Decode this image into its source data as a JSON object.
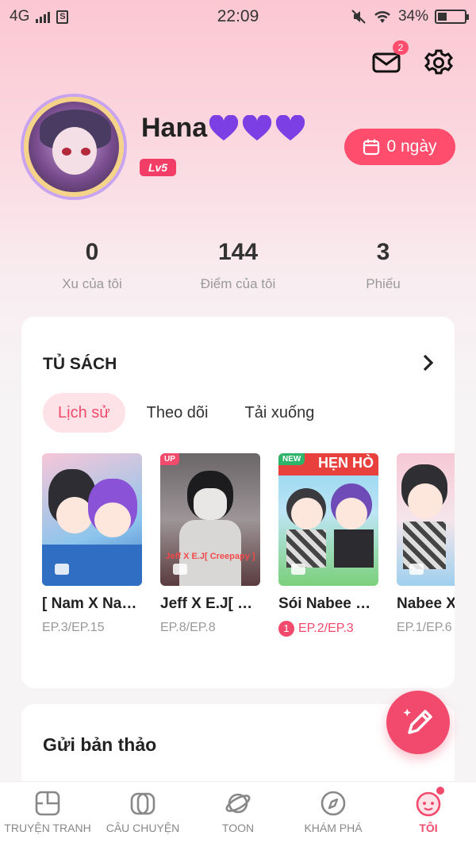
{
  "status_bar": {
    "network": "4G",
    "time": "22:09",
    "battery_percent": "34%",
    "battery_level": 0.34
  },
  "header": {
    "mail_badge": "2"
  },
  "profile": {
    "name": "Hana",
    "level": "Lv5",
    "checkin_label": "0 ngày"
  },
  "stats": [
    {
      "value": "0",
      "label": "Xu của tôi"
    },
    {
      "value": "144",
      "label": "Điểm của tôi"
    },
    {
      "value": "3",
      "label": "Phiếu"
    }
  ],
  "bookshelf": {
    "title": "TỦ SÁCH",
    "tabs": [
      "Lịch sử",
      "Theo dõi",
      "Tải xuống"
    ],
    "active_tab": 0,
    "books": [
      {
        "title": "[ Nam X Nabee ]",
        "episode": "EP.3/EP.15",
        "tag": "",
        "unread": ""
      },
      {
        "title": "Jeff X E.J[ Creepapy ]",
        "episode": "EP.8/EP.8",
        "tag": "UP",
        "unread": "",
        "cover_text": "Jeff X E.J[ Creepapy ]"
      },
      {
        "title": "Sói Nabee X Hana",
        "episode": "EP.2/EP.3",
        "tag": "NEW",
        "unread": "1",
        "cover_text": "HẸN HÒ"
      },
      {
        "title": "Nabee X",
        "episode": "EP.1/EP.6",
        "tag": "",
        "unread": ""
      }
    ]
  },
  "submit": {
    "title": "Gửi bản thảo"
  },
  "bottom_nav": [
    {
      "label": "TRUYỆN TRANH",
      "icon": "comic-icon"
    },
    {
      "label": "CÂU CHUYỆN",
      "icon": "book-icon"
    },
    {
      "label": "TOON",
      "icon": "planet-icon"
    },
    {
      "label": "KHÁM PHÁ",
      "icon": "compass-icon"
    },
    {
      "label": "TÔI",
      "icon": "profile-icon"
    }
  ],
  "colors": {
    "accent": "#f24a6c",
    "tab_active_bg": "#fde3e8",
    "heart": "#7b3fe4"
  }
}
